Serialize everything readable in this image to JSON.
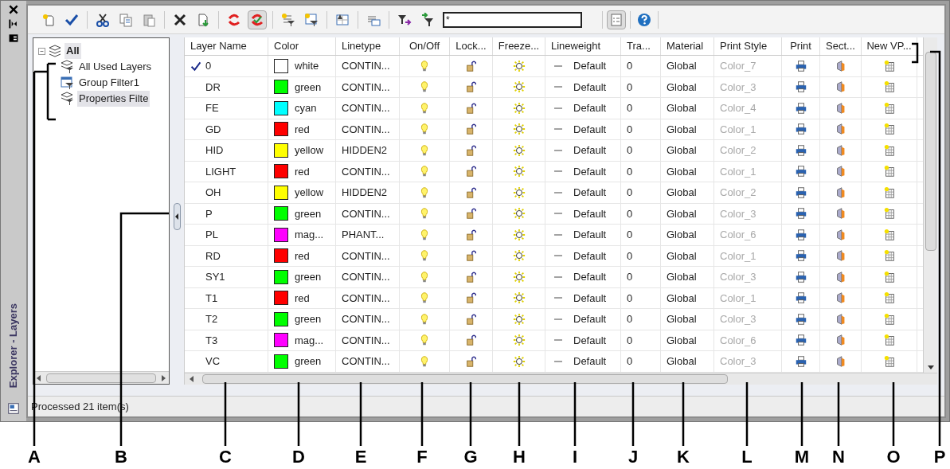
{
  "side_strip": {
    "title": "Explorer - Layers"
  },
  "toolbar": {
    "filter_value": "*"
  },
  "tree": {
    "label": "All",
    "expanded": true,
    "selected": false,
    "children": [
      {
        "label": "All Used Layers",
        "kind": "filter",
        "selected": false
      },
      {
        "label": "Group Filter1",
        "kind": "group",
        "selected": false
      },
      {
        "label": "Properties Filte",
        "kind": "filter",
        "selected": true
      }
    ]
  },
  "table": {
    "columns": [
      "Layer Name",
      "Color",
      "Linetype",
      "On/Off",
      "Lock...",
      "Freeze...",
      "Lineweight",
      "Tra...",
      "Material",
      "Print Style",
      "Print",
      "Sect...",
      "New VP..."
    ],
    "rows": [
      {
        "name": "0",
        "current": true,
        "color": "#ffffff",
        "color_name": "white",
        "linetype": "CONTIN...",
        "lineweight": "Default",
        "transparency": "0",
        "material": "Global",
        "print_style": "Color_7"
      },
      {
        "name": "DR",
        "current": false,
        "color": "#00ff00",
        "color_name": "green",
        "linetype": "CONTIN...",
        "lineweight": "Default",
        "transparency": "0",
        "material": "Global",
        "print_style": "Color_3"
      },
      {
        "name": "FE",
        "current": false,
        "color": "#00ffff",
        "color_name": "cyan",
        "linetype": "CONTIN...",
        "lineweight": "Default",
        "transparency": "0",
        "material": "Global",
        "print_style": "Color_4"
      },
      {
        "name": "GD",
        "current": false,
        "color": "#ff0000",
        "color_name": "red",
        "linetype": "CONTIN...",
        "lineweight": "Default",
        "transparency": "0",
        "material": "Global",
        "print_style": "Color_1"
      },
      {
        "name": "HID",
        "current": false,
        "color": "#ffff00",
        "color_name": "yellow",
        "linetype": "HIDDEN2",
        "lineweight": "Default",
        "transparency": "0",
        "material": "Global",
        "print_style": "Color_2"
      },
      {
        "name": "LIGHT",
        "current": false,
        "color": "#ff0000",
        "color_name": "red",
        "linetype": "CONTIN...",
        "lineweight": "Default",
        "transparency": "0",
        "material": "Global",
        "print_style": "Color_1"
      },
      {
        "name": "OH",
        "current": false,
        "color": "#ffff00",
        "color_name": "yellow",
        "linetype": "HIDDEN2",
        "lineweight": "Default",
        "transparency": "0",
        "material": "Global",
        "print_style": "Color_2"
      },
      {
        "name": "P",
        "current": false,
        "color": "#00ff00",
        "color_name": "green",
        "linetype": "CONTIN...",
        "lineweight": "Default",
        "transparency": "0",
        "material": "Global",
        "print_style": "Color_3"
      },
      {
        "name": "PL",
        "current": false,
        "color": "#ff00ff",
        "color_name": "mag...",
        "linetype": "PHANT...",
        "lineweight": "Default",
        "transparency": "0",
        "material": "Global",
        "print_style": "Color_6"
      },
      {
        "name": "RD",
        "current": false,
        "color": "#ff0000",
        "color_name": "red",
        "linetype": "CONTIN...",
        "lineweight": "Default",
        "transparency": "0",
        "material": "Global",
        "print_style": "Color_1"
      },
      {
        "name": "SY1",
        "current": false,
        "color": "#00ff00",
        "color_name": "green",
        "linetype": "CONTIN...",
        "lineweight": "Default",
        "transparency": "0",
        "material": "Global",
        "print_style": "Color_3"
      },
      {
        "name": "T1",
        "current": false,
        "color": "#ff0000",
        "color_name": "red",
        "linetype": "CONTIN...",
        "lineweight": "Default",
        "transparency": "0",
        "material": "Global",
        "print_style": "Color_1"
      },
      {
        "name": "T2",
        "current": false,
        "color": "#00ff00",
        "color_name": "green",
        "linetype": "CONTIN...",
        "lineweight": "Default",
        "transparency": "0",
        "material": "Global",
        "print_style": "Color_3"
      },
      {
        "name": "T3",
        "current": false,
        "color": "#ff00ff",
        "color_name": "mag...",
        "linetype": "CONTIN...",
        "lineweight": "Default",
        "transparency": "0",
        "material": "Global",
        "print_style": "Color_6"
      },
      {
        "name": "VC",
        "current": false,
        "color": "#00ff00",
        "color_name": "green",
        "linetype": "CONTIN...",
        "lineweight": "Default",
        "transparency": "0",
        "material": "Global",
        "print_style": "Color_3"
      }
    ]
  },
  "status_bar": {
    "text": "Processed 21 item(s)"
  },
  "callouts": [
    "A",
    "B",
    "C",
    "D",
    "E",
    "F",
    "G",
    "H",
    "I",
    "J",
    "K",
    "L",
    "M",
    "N",
    "O",
    "P"
  ]
}
